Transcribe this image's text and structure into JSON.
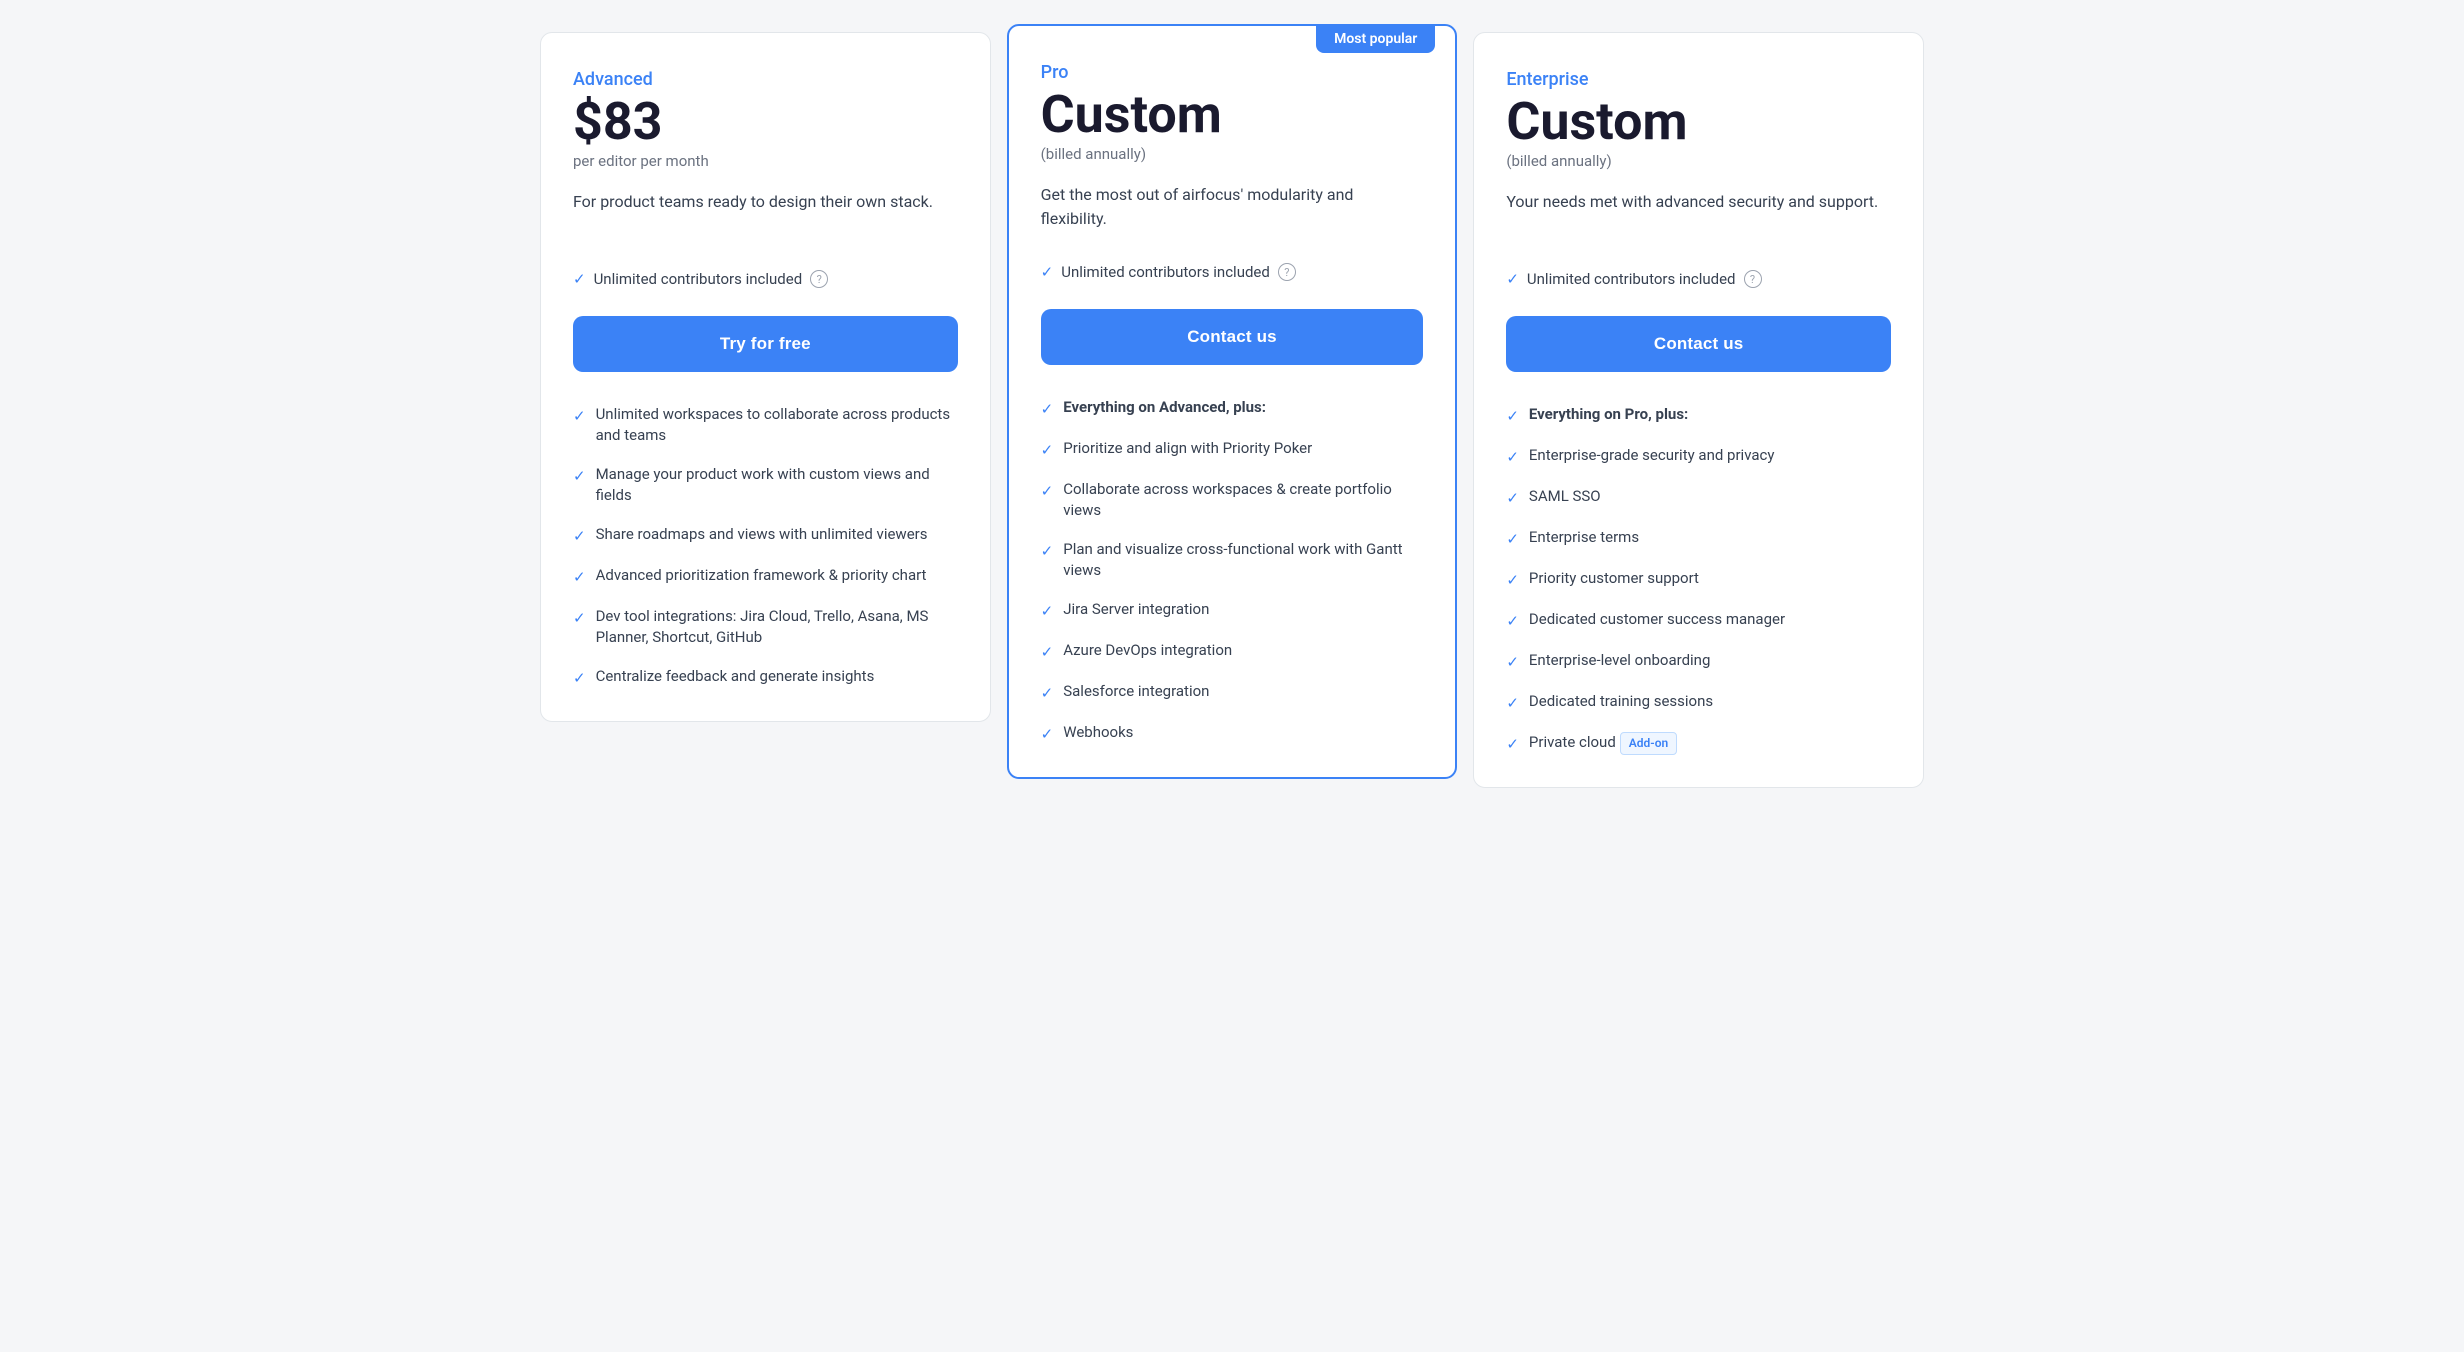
{
  "plans": [
    {
      "id": "advanced",
      "type": "Advanced",
      "price": "$83",
      "price_label": "per editor per month",
      "description": "For product teams ready to design their own stack.",
      "highlight_feature": "Unlimited contributors included",
      "cta_label": "Try for free",
      "most_popular": false,
      "featured": false,
      "features": [
        "Unlimited workspaces to collaborate across products and teams",
        "Manage your product work with custom views and fields",
        "Share roadmaps and views with unlimited viewers",
        "Advanced prioritization framework & priority chart",
        "Dev tool integrations: Jira Cloud, Trello, Asana, MS Planner, Shortcut, GitHub",
        "Centralize feedback and generate insights"
      ]
    },
    {
      "id": "pro",
      "type": "Pro",
      "price": "Custom",
      "price_label": "(billed annually)",
      "description": "Get the most out of airfocus' modularity and flexibility.",
      "highlight_feature": "Unlimited contributors included",
      "cta_label": "Contact us",
      "most_popular": true,
      "featured": true,
      "most_popular_label": "Most popular",
      "features": [
        {
          "bold": "Everything on Advanced, plus:"
        },
        "Prioritize and align with Priority Poker",
        "Collaborate across workspaces & create portfolio views",
        "Plan and visualize cross-functional work with Gantt views",
        "Jira Server integration",
        "Azure DevOps integration",
        "Salesforce integration",
        "Webhooks"
      ]
    },
    {
      "id": "enterprise",
      "type": "Enterprise",
      "price": "Custom",
      "price_label": "(billed annually)",
      "description": "Your needs met with advanced security and support.",
      "highlight_feature": "Unlimited contributors included",
      "cta_label": "Contact us",
      "most_popular": false,
      "featured": false,
      "features": [
        {
          "bold": "Everything on Pro, plus:"
        },
        "Enterprise-grade security and privacy",
        "SAML SSO",
        "Enterprise terms",
        "Priority customer support",
        "Dedicated customer success manager",
        "Enterprise-level onboarding",
        "Dedicated training sessions",
        {
          "text": "Private cloud",
          "addon": "Add-on"
        }
      ]
    }
  ]
}
